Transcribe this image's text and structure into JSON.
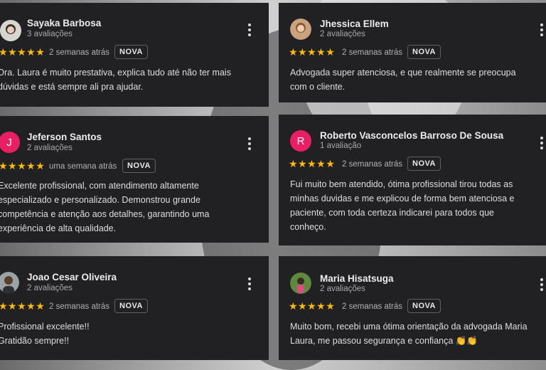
{
  "badge_label": "NOVA",
  "stars": "★★★★★",
  "kebab_icon": "more-vertical-icon",
  "colors": {
    "card_bg": "#212124",
    "star": "#fbbc04",
    "avatar_j": "#e91e63",
    "avatar_r": "#e91e63"
  },
  "reviews": [
    {
      "name": "Sayaka Barbosa",
      "count": "3 avaliações",
      "time": "2 semanas atrás",
      "avatar_letter": "",
      "text": "Dra. Laura é muito prestativa, explica tudo até não ter mais\ndúvidas e está sempre ali pra ajudar."
    },
    {
      "name": "Jhessica Ellem",
      "count": "2 avaliações",
      "time": "2 semanas atrás",
      "avatar_letter": "",
      "text": "Advogada super atenciosa, e que realmente se preocupa\ncom o cliente."
    },
    {
      "name": "Jeferson Santos",
      "count": "2 avaliações",
      "time": "uma semana atrás",
      "avatar_letter": "J",
      "text": "Excelente profissional, com atendimento altamente\nespecializado e personalizado. Demonstrou grande\ncompetência e atenção aos detalhes, garantindo uma\nexperiência de alta qualidade."
    },
    {
      "name": "Roberto Vasconcelos Barroso De Sousa",
      "count": "1 avaliação",
      "time": "2 semanas atrás",
      "avatar_letter": "R",
      "text": "Fui muito bem atendido, ótima profissional tirou todas as\nminhas duvidas e me explicou de forma bem atenciosa e\npaciente, com toda certeza indicarei para todos que\nconheço."
    },
    {
      "name": "Joao Cesar Oliveira",
      "count": "2 avaliações",
      "time": "2 semanas atrás",
      "avatar_letter": "",
      "text": "Profissional excelente!!\nGratidão sempre!!"
    },
    {
      "name": "Maria Hisatsuga",
      "count": "2 avaliações",
      "time": "2 semanas atrás",
      "avatar_letter": "",
      "text": "Muito bom, recebi uma ótima orientação da advogada Maria\nLaura, me passou segurança e confiança 👏👏"
    }
  ]
}
